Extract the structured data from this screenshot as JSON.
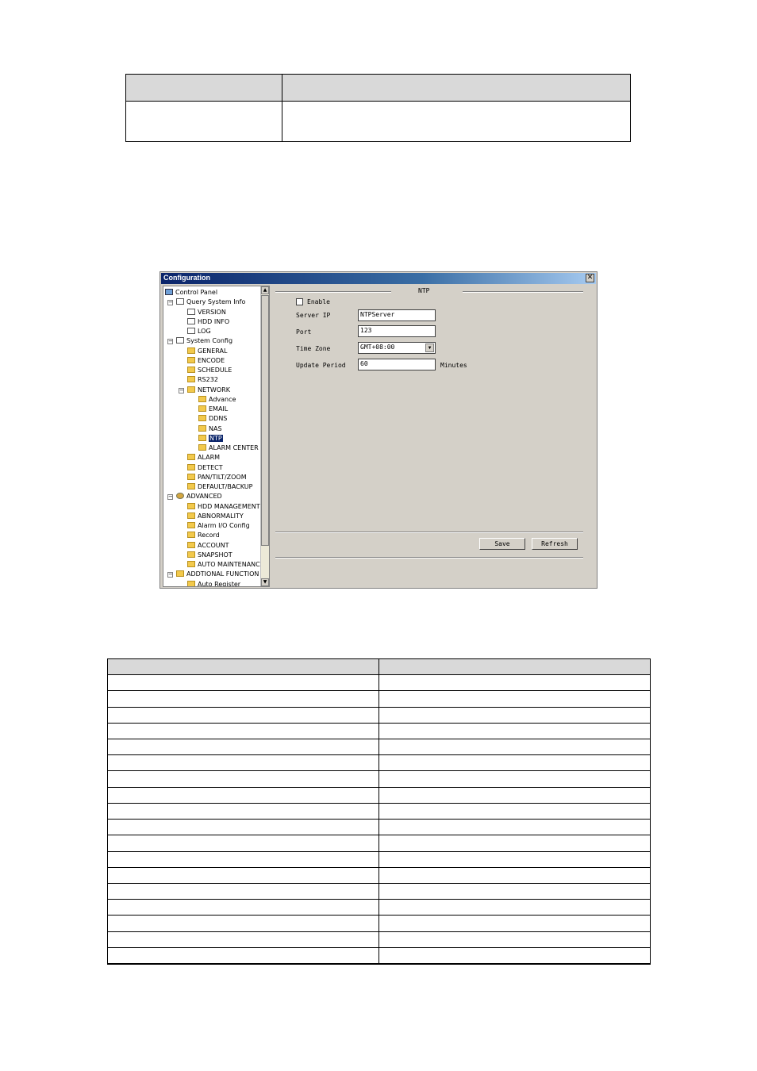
{
  "top_table": {
    "header": [
      "",
      ""
    ],
    "rows": [
      [
        "",
        ""
      ]
    ]
  },
  "dialog": {
    "title": "Configuration",
    "close_label": "✕",
    "tree": [
      {
        "label": "Control Panel",
        "icon": "pc-icon"
      },
      {
        "label": "Query System Info",
        "icon": "doc-icon"
      },
      {
        "label": "VERSION",
        "icon": "doc-icon"
      },
      {
        "label": "HDD INFO",
        "icon": "doc-icon"
      },
      {
        "label": "LOG",
        "icon": "doc-icon"
      },
      {
        "label": "System Config",
        "icon": "settings-icon"
      },
      {
        "label": "GENERAL",
        "icon": "folder-icon"
      },
      {
        "label": "ENCODE",
        "icon": "folder-icon"
      },
      {
        "label": "SCHEDULE",
        "icon": "folder-icon"
      },
      {
        "label": "RS232",
        "icon": "folder-icon"
      },
      {
        "label": "NETWORK",
        "icon": "folder-icon"
      },
      {
        "label": "Advance",
        "icon": "folder-icon"
      },
      {
        "label": "EMAIL",
        "icon": "folder-icon"
      },
      {
        "label": "DDNS",
        "icon": "folder-icon"
      },
      {
        "label": "NAS",
        "icon": "folder-icon"
      },
      {
        "label": "NTP",
        "icon": "folder-icon"
      },
      {
        "label": "ALARM CENTER",
        "icon": "folder-icon"
      },
      {
        "label": "ALARM",
        "icon": "folder-icon"
      },
      {
        "label": "DETECT",
        "icon": "folder-icon"
      },
      {
        "label": "PAN/TILT/ZOOM",
        "icon": "folder-icon"
      },
      {
        "label": "DEFAULT/BACKUP",
        "icon": "folder-icon"
      },
      {
        "label": "ADVANCED",
        "icon": "gear-icon"
      },
      {
        "label": "HDD MANAGEMENT",
        "icon": "folder-icon"
      },
      {
        "label": "ABNORMALITY",
        "icon": "folder-icon"
      },
      {
        "label": "Alarm I/O Config",
        "icon": "folder-icon"
      },
      {
        "label": "Record",
        "icon": "folder-icon"
      },
      {
        "label": "ACCOUNT",
        "icon": "folder-icon"
      },
      {
        "label": "SNAPSHOT",
        "icon": "folder-icon"
      },
      {
        "label": "AUTO MAINTENANCE",
        "icon": "folder-icon"
      },
      {
        "label": "ADDTIONAL FUNCTION",
        "icon": "folder-icon"
      },
      {
        "label": "Auto Register",
        "icon": "folder-icon"
      }
    ],
    "ntp": {
      "group_title": "NTP",
      "enable_label": "Enable",
      "enable_checked": false,
      "server_ip_label": "Server IP",
      "server_ip_value": "NTPServer",
      "port_label": "Port",
      "port_value": "123",
      "time_zone_label": "Time Zone",
      "time_zone_value": "GMT+08:00",
      "update_period_label": "Update Period",
      "update_period_value": "60",
      "update_period_unit": "Minutes",
      "save_label": "Save",
      "refresh_label": "Refresh"
    }
  },
  "bottom_table": {
    "header": [
      "",
      ""
    ],
    "rows": [
      [
        "",
        ""
      ],
      [
        "",
        ""
      ],
      [
        "",
        ""
      ],
      [
        "",
        ""
      ],
      [
        "",
        ""
      ],
      [
        "",
        ""
      ],
      [
        "",
        ""
      ],
      [
        "",
        ""
      ],
      [
        "",
        ""
      ],
      [
        "",
        ""
      ],
      [
        "",
        ""
      ],
      [
        "",
        ""
      ],
      [
        "",
        ""
      ],
      [
        "",
        ""
      ],
      [
        "",
        ""
      ],
      [
        "",
        ""
      ],
      [
        "",
        ""
      ],
      [
        "",
        ""
      ]
    ]
  }
}
